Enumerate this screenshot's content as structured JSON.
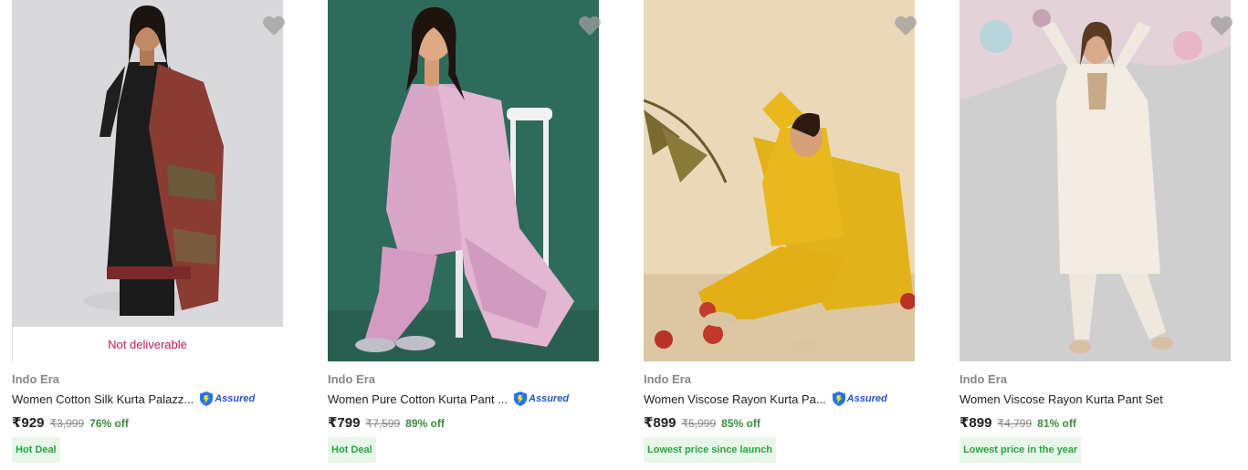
{
  "products": [
    {
      "brand": "Indo Era",
      "title": "Women Cotton Silk Kurta Palazz...",
      "assured": true,
      "assured_label": "Assured",
      "price": "₹929",
      "mrp": "₹3,999",
      "discount": "76% off",
      "deal": "Hot Deal",
      "availability": "Not deliverable",
      "image_icon": "kurta-photo-black-with-dupatta"
    },
    {
      "brand": "Indo Era",
      "title": "Women Pure Cotton Kurta Pant ...",
      "assured": true,
      "assured_label": "Assured",
      "price": "₹799",
      "mrp": "₹7,599",
      "discount": "89% off",
      "deal": "Hot Deal",
      "image_icon": "kurta-photo-pink-printed"
    },
    {
      "brand": "Indo Era",
      "title": "Women Viscose Rayon Kurta Pa...",
      "assured": true,
      "assured_label": "Assured",
      "price": "₹899",
      "mrp": "₹5,999",
      "discount": "85% off",
      "deal": "Lowest price since launch",
      "image_icon": "kurta-photo-yellow"
    },
    {
      "brand": "Indo Era",
      "title": "Women Viscose Rayon Kurta Pant Set",
      "assured": false,
      "price": "₹899",
      "mrp": "₹4,799",
      "discount": "81% off",
      "deal": "Lowest price in the year",
      "image_icon": "kurta-photo-white"
    }
  ],
  "colors": {
    "discount": "#388e3c",
    "deal_bg": "#e8f7ea",
    "deal_text": "#26a541",
    "not_deliverable": "#c2185b",
    "assured": "#2455c3",
    "wishlist_heart": "#9e9e9e"
  }
}
